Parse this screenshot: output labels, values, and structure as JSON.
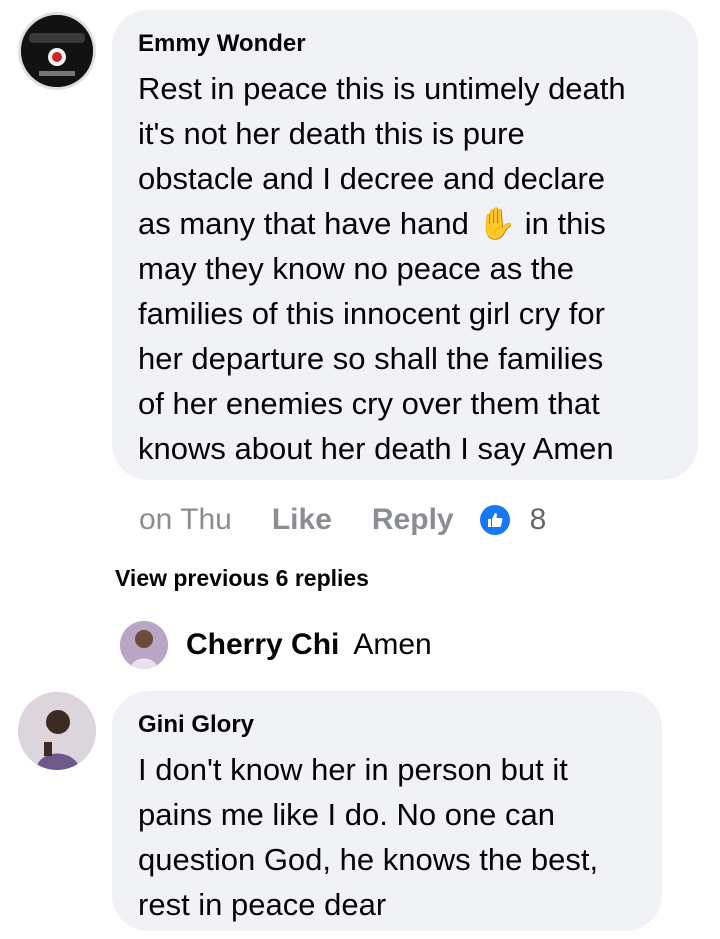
{
  "comments": [
    {
      "author": "Emmy Wonder",
      "avatar_text": "Emmy Wonder",
      "text": "Rest in peace this is untimely death\nit's not her death this is pure\nobstacle and I decree and declare\nas many that have hand ✋ in this\nmay they know no peace as the\nfamilies of this innocent girl cry for\nher departure so shall the families\nof her enemies cry over them that\nknows about her death I say Amen",
      "time": "on Thu",
      "like_label": "Like",
      "reply_label": "Reply",
      "reaction_count": "8",
      "reaction_icon": "thumbs-up-icon"
    },
    {
      "author": "Gini Glory",
      "text": "I don't know her in person but it\npains me like I do. No one can\nquestion God, he knows the best,\nrest in peace dear"
    }
  ],
  "view_previous": "View previous 6 replies",
  "inline_reply": {
    "author": "Cherry Chi",
    "text": "Amen"
  },
  "colors": {
    "bubble": "#f0f2f5",
    "meta": "#8a8d91",
    "reaction": "#1877f2"
  }
}
